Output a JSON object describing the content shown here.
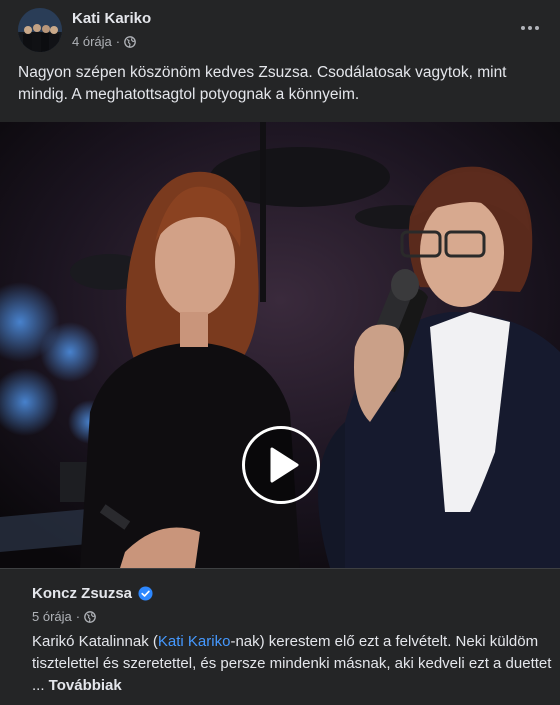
{
  "post": {
    "author": "Kati Kariko",
    "time": "4 órája",
    "privacy_icon": "globe-icon",
    "text": "Nagyon szépen köszönöm kedves Zsuzsa. Csodálatosak vagytok, mint mindig. A meghatottsagtol potyognak a könnyeim."
  },
  "video": {
    "play_icon": "play-icon"
  },
  "shared_post": {
    "author": "Koncz Zsuzsa",
    "verified_icon": "verified-badge-icon",
    "time": "5 órája",
    "text_before": "Karikó Katalinnak (",
    "mention": "Kati Kariko",
    "text_middle": "-nak) kerestem elő ezt a felvételt. Neki küldöm tisztelettel és szeretettel, és persze mindenki másnak, aki kedveli ezt a duettet ... ",
    "see_more": "Továbbiak"
  },
  "colors": {
    "background": "#242526",
    "text": "#e4e6eb",
    "secondary_text": "#b0b3b8",
    "link": "#4599ff",
    "verified": "#2d88ff"
  }
}
